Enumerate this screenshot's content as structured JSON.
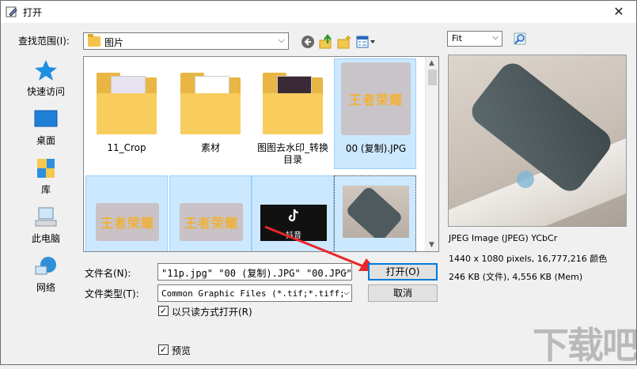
{
  "window": {
    "title": "打开"
  },
  "lookin": {
    "label": "查找范围(I):",
    "value": "图片"
  },
  "places": [
    {
      "label": "快速访问"
    },
    {
      "label": "桌面"
    },
    {
      "label": "库"
    },
    {
      "label": "此电脑"
    },
    {
      "label": "网络"
    }
  ],
  "files": [
    {
      "name": "11_Crop"
    },
    {
      "name": "素材"
    },
    {
      "name": "图图去水印_转换目录"
    },
    {
      "name": "00 (复制).JPG"
    },
    {
      "name": ""
    },
    {
      "name": ""
    },
    {
      "name": ""
    },
    {
      "name": ""
    }
  ],
  "thumbnails": {
    "logo_text": "王者荣耀",
    "tiktok_caption": "抖音"
  },
  "filename": {
    "label": "文件名(N):",
    "value": "\"11p.jpg\" \"00 (复制).JPG\" \"00.JPG\" \"0"
  },
  "filetype": {
    "label": "文件类型(T):",
    "value": "Common Graphic Files (*.tif;*.tiff;*."
  },
  "buttons": {
    "open": "打开(O)",
    "cancel": "取消"
  },
  "readonly": {
    "label": "以只读方式打开(R)",
    "checked": true
  },
  "preview_toggle": {
    "label": "预览",
    "checked": true
  },
  "preview": {
    "zoom_mode": "Fit",
    "format": "JPEG Image (JPEG) YCbCr",
    "dimensions": "1440 x 1080 pixels, 16,777,216 颜色",
    "size": "246 KB (文件), 4,556 KB (Mem)"
  },
  "watermark": {
    "text": "下载吧"
  },
  "colors": {
    "selection": "#cce8ff",
    "accent": "#0078d7",
    "arrow": "#e8262b"
  }
}
